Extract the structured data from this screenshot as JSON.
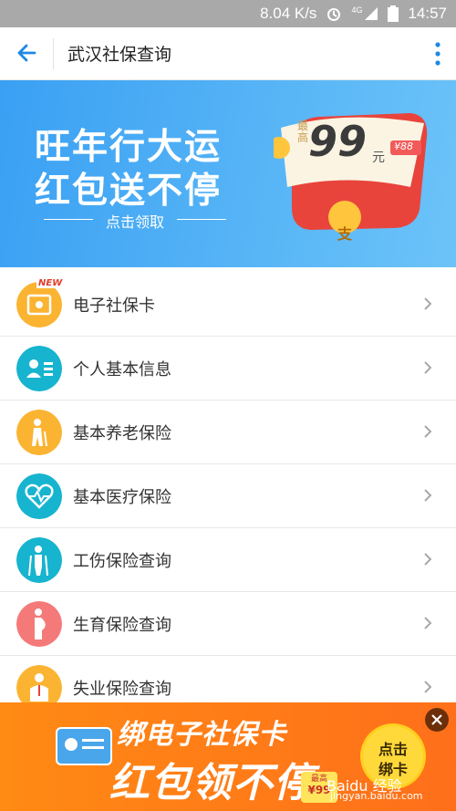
{
  "status_bar": {
    "network_speed": "8.04 K/s",
    "network_type": "4G",
    "time": "14:57",
    "icons": [
      "alarm-icon",
      "signal-icon",
      "battery-icon"
    ]
  },
  "app_bar": {
    "title": "武汉社保查询",
    "back_icon": "back-arrow-icon",
    "more_icon": "more-vertical-icon",
    "accent_color": "#1e88e5"
  },
  "banner": {
    "line1": "旺年行大运",
    "line2": "红包送不停",
    "cta": "点击领取",
    "redpack_label": "最高",
    "redpack_amount": "99",
    "redpack_unit": "元",
    "tag": "¥88",
    "coin": "支"
  },
  "menu": [
    {
      "label": "电子社保卡",
      "icon": "social-security-card-icon",
      "color": "#fbb431",
      "badge": "NEW"
    },
    {
      "label": "个人基本信息",
      "icon": "id-info-icon",
      "color": "#17b4cf"
    },
    {
      "label": "基本养老保险",
      "icon": "elderly-icon",
      "color": "#fbb431"
    },
    {
      "label": "基本医疗保险",
      "icon": "heart-pulse-icon",
      "color": "#17b4cf"
    },
    {
      "label": "工伤保险查询",
      "icon": "injury-icon",
      "color": "#17b4cf"
    },
    {
      "label": "生育保险查询",
      "icon": "pregnancy-icon",
      "color": "#f47a7a"
    },
    {
      "label": "失业保险查询",
      "icon": "unemployment-icon",
      "color": "#fbb431"
    }
  ],
  "bottom_ad": {
    "line1": "绑电子社保卡",
    "line2": "红包领不停",
    "button_line1": "点击",
    "button_line2": "绑卡",
    "price_label": "最高",
    "price": "¥99"
  },
  "watermark": {
    "logo": "Baidu 经验",
    "url": "jingyan.baidu.com"
  }
}
